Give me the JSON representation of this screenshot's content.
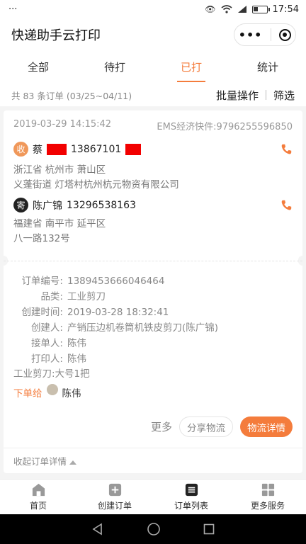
{
  "statusbar": {
    "left": "···",
    "time": "17:54"
  },
  "titlebar": {
    "title": "快递助手云打印",
    "menu_glyph": "•••"
  },
  "tabs": [
    {
      "label": "全部"
    },
    {
      "label": "待打"
    },
    {
      "label": "已打",
      "active": true
    },
    {
      "label": "统计"
    }
  ],
  "summary": {
    "text": "共 83 条订单 (03/25~04/11)",
    "batch": "批量操作",
    "filter": "筛选"
  },
  "order": {
    "date": "2019-03-29 14:15:42",
    "waybill": "EMS经济快件:9796255596850",
    "receiver": {
      "badge": "收",
      "name": "蔡",
      "phone": "13867101",
      "addr1": "浙江省 杭州市 萧山区",
      "addr2": "义蓬街道 灯塔村杭州杭元物资有限公司"
    },
    "sender": {
      "badge": "寄",
      "name": "陈广锦",
      "phone": "13296538163",
      "addr1": "福建省 南平市 延平区",
      "addr2": "八一路132号"
    },
    "details": [
      {
        "k": "订单编号:",
        "v": "1389453666046464"
      },
      {
        "k": "品类:",
        "v": "工业剪刀"
      },
      {
        "k": "创建时间:",
        "v": "2019-03-28 18:32:41"
      },
      {
        "k": "创建人:",
        "v": "产销压边机卷筒机铁皮剪刀(陈广锦)"
      },
      {
        "k": "接单人:",
        "v": "陈伟"
      },
      {
        "k": "打印人:",
        "v": "陈伟"
      }
    ],
    "item": "工业剪刀:大号1把",
    "assign_label": "下单给",
    "assign_name": "陈伟",
    "more": "更多",
    "share": "分享物流",
    "logistics": "物流详情",
    "collapse": "收起订单详情"
  },
  "navbar": [
    {
      "label": "首页",
      "icon": "home-icon"
    },
    {
      "label": "创建订单",
      "icon": "plus-square-icon"
    },
    {
      "label": "订单列表",
      "icon": "list-icon",
      "active": true
    },
    {
      "label": "更多服务",
      "icon": "grid-icon"
    }
  ],
  "colors": {
    "accent": "#f47c3c",
    "redaction": "#f20000"
  }
}
